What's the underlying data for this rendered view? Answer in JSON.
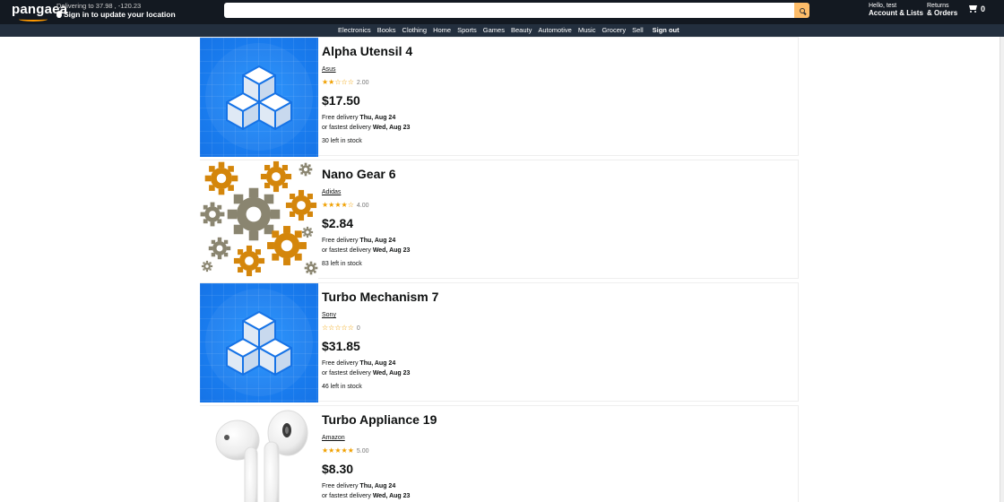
{
  "header": {
    "logo": "pangaea",
    "deliver_line1": "Delivering to 37.98 , -120.23",
    "deliver_line2": "Sign in to update your location",
    "search_placeholder": "",
    "account_line1": "Hello, test",
    "account_line2": "Account & Lists",
    "orders_line1": "Returns",
    "orders_line2": "& Orders",
    "cart_count": "0"
  },
  "nav": {
    "items": [
      "Electronics",
      "Books",
      "Clothing",
      "Home",
      "Sports",
      "Games",
      "Beauty",
      "Automotive",
      "Music",
      "Grocery",
      "Sell"
    ],
    "signout": "Sign out"
  },
  "products": [
    {
      "title": "Alpha Utensil 4",
      "brand": "Asus",
      "rating": 2,
      "rating_text": "2.00",
      "price": "$17.50",
      "free_delivery_label": "Free delivery",
      "free_delivery_date": "Thu, Aug 24",
      "fast_label": "or fastest delivery",
      "fast_date": "Wed, Aug 23",
      "stock": "30 left in stock",
      "image": "cubes-icon"
    },
    {
      "title": "Nano Gear 6",
      "brand": "Adidas",
      "rating": 4,
      "rating_text": "4.00",
      "price": "$2.84",
      "free_delivery_label": "Free delivery",
      "free_delivery_date": "Thu, Aug 24",
      "fast_label": "or fastest delivery",
      "fast_date": "Wed, Aug 23",
      "stock": "83 left in stock",
      "image": "gears-icon"
    },
    {
      "title": "Turbo Mechanism 7",
      "brand": "Sony",
      "rating": 0,
      "rating_text": "0",
      "price": "$31.85",
      "free_delivery_label": "Free delivery",
      "free_delivery_date": "Thu, Aug 24",
      "fast_label": "or fastest delivery",
      "fast_date": "Wed, Aug 23",
      "stock": "46 left in stock",
      "image": "cubes-icon"
    },
    {
      "title": "Turbo Appliance 19",
      "brand": "Amazon",
      "rating": 5,
      "rating_text": "5.00",
      "price": "$8.30",
      "free_delivery_label": "Free delivery",
      "free_delivery_date": "Thu, Aug 24",
      "fast_label": "or fastest delivery",
      "fast_date": "Wed, Aug 23",
      "stock": "",
      "image": "earbuds-icon"
    }
  ],
  "colors": {
    "topbar": "#131921",
    "subnav": "#232f3e",
    "search_button": "#febd69",
    "star": "#f0a000"
  }
}
